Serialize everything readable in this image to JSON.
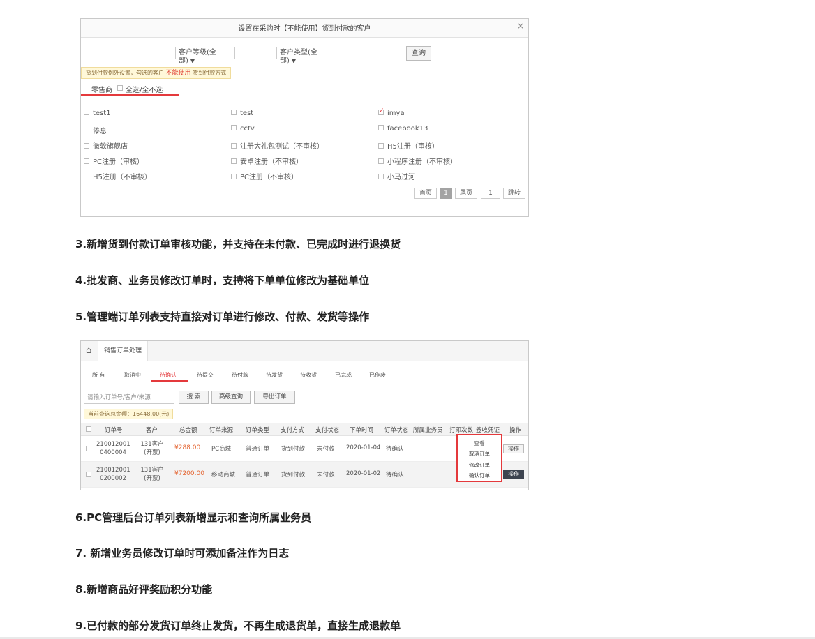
{
  "dialog": {
    "title": "设置在采购时【不能使用】货到付款的客户",
    "close": "×",
    "search_value": "",
    "level_select": "客户等级(全部)",
    "type_select": "客户类型(全部)",
    "query_button": "查询",
    "hint_prefix": "货到付款例外设置，勾选的客户",
    "hint_em": "不能使用",
    "hint_suffix": "货到付款方式",
    "tab_label": "零售商",
    "select_all": "全选/全不选",
    "customers": [
      {
        "name": "test1",
        "checked": false
      },
      {
        "name": "test",
        "checked": false
      },
      {
        "name": "imya",
        "checked": true
      },
      {
        "name": "傣息",
        "checked": false
      },
      {
        "name": "cctv",
        "checked": false
      },
      {
        "name": "facebook13",
        "checked": false
      },
      {
        "name": "微软旗舰店",
        "checked": false
      },
      {
        "name": "注册大礼包测试（不审核）",
        "checked": false
      },
      {
        "name": "H5注册（审核）",
        "checked": false
      },
      {
        "name": "PC注册（审核）",
        "checked": false
      },
      {
        "name": "安卓注册（不审核）",
        "checked": false
      },
      {
        "name": "小程序注册（不审核）",
        "checked": false
      },
      {
        "name": "H5注册（不审核）",
        "checked": false
      },
      {
        "name": "PC注册（不审核）",
        "checked": false
      },
      {
        "name": "小马过河",
        "checked": false
      }
    ],
    "pager": {
      "first": "首页",
      "current": "1",
      "last": "尾页",
      "jump_value": "1",
      "jump": "跳转"
    }
  },
  "headings": {
    "h3": "3.新增货到付款订单审核功能，并支持在未付款、已完成时进行退换货",
    "h4": "4.批发商、业务员修改订单时，支持将下单单位修改为基础单位",
    "h5": "5.管理端订单列表支持直接对订单进行修改、付款、发货等操作",
    "h6": "6.PC管理后台订单列表新增显示和查询所属业务员",
    "h7": "7. 新增业务员修改订单时可添加备注作为日志",
    "h8": "8.新增商品好评奖励积分功能",
    "h9": "9.已付款的部分发货订单终止发货，不再生成退货单，直接生成退款单"
  },
  "orders": {
    "home_icon": "home-icon",
    "breadcrumb": "销售订单处理",
    "statuses": [
      "所 有",
      "取消中",
      "待确认",
      "待提交",
      "待付款",
      "待发货",
      "待收货",
      "已完成",
      "已作废"
    ],
    "active_status": "待确认",
    "search_placeholder": "请输入订单号/客户/来源",
    "search_button": "搜 索",
    "advanced_button": "高级查询",
    "export_button": "导出订单",
    "total_text": "当前查询总金额：16448.00(元)",
    "columns": [
      "订单号",
      "客户",
      "总金额",
      "订单来源",
      "订单类型",
      "支付方式",
      "支付状态",
      "下单时间",
      "订单状态",
      "所属业务员",
      "打印次数",
      "签收凭证",
      "操作"
    ],
    "rows": [
      {
        "order_no_1": "210012001",
        "order_no_2": "0400004",
        "customer_1": "131客户",
        "customer_2": "(开票)",
        "amount": "¥288.00",
        "source": "PC商城",
        "type": "普通订单",
        "pay_method": "货到付款",
        "pay_status": "未付款",
        "time": "2020-01-04",
        "status": "待确认",
        "op": "操作"
      },
      {
        "order_no_1": "210012001",
        "order_no_2": "0200002",
        "customer_1": "131客户",
        "customer_2": "(开票)",
        "amount": "¥7200.00",
        "source": "移动商城",
        "type": "普通订单",
        "pay_method": "货到付款",
        "pay_status": "未付款",
        "time": "2020-01-02",
        "status": "待确认",
        "op": "操作"
      }
    ],
    "menu": [
      "查看",
      "取消订单",
      "修改订单",
      "确认订单"
    ]
  },
  "colors": {
    "accent": "#e4393c",
    "price": "#e4632f",
    "dark_button": "#3d4450"
  }
}
